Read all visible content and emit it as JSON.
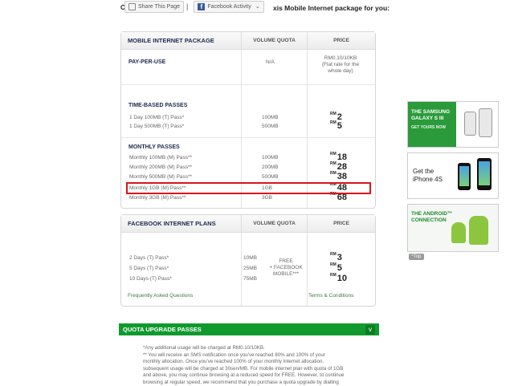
{
  "topbar": {
    "share_label": "Share This Page",
    "fb_label": "Facebook Activity",
    "intro_prefix": "C",
    "intro_text": "xis Mobile Internet package for you:"
  },
  "main_table": {
    "headers": {
      "package": "MOBILE INTERNET PACKAGE",
      "quota": "VOLUME QUOTA",
      "price": "PRICE"
    },
    "pay_per_use": {
      "title": "PAY-PER-USE",
      "quota": "N/A",
      "price_lines": [
        "RM0.10/10KB",
        "(Flat rate for the",
        "whole day)"
      ]
    },
    "time_based": {
      "title": "TIME-BASED PASSES",
      "rows": [
        {
          "name": "1 Day 100MB (T) Pass*",
          "quota": "100MB",
          "currency": "RM",
          "price": "2"
        },
        {
          "name": "1 Day 500MB (T) Pass*",
          "quota": "500MB",
          "currency": "RM",
          "price": "5"
        }
      ]
    },
    "monthly": {
      "title": "MONTHLY PASSES",
      "rows": [
        {
          "name": "Monthly 100MB (M) Pass**",
          "quota": "100MB",
          "currency": "RM",
          "price": "18"
        },
        {
          "name": "Monthly 200MB (M) Pass**",
          "quota": "200MB",
          "currency": "RM",
          "price": "28"
        },
        {
          "name": "Monthly 500MB (M) Pass**",
          "quota": "500MB",
          "currency": "RM",
          "price": "38"
        },
        {
          "name": "Monthly 1GB (M) Pass**",
          "quota": "1GB",
          "currency": "RM",
          "price": "48"
        },
        {
          "name": "Monthly 3GB (M) Pass**",
          "quota": "3GB",
          "currency": "RM",
          "price": "68"
        }
      ]
    }
  },
  "fb_table": {
    "headers": {
      "package": "FACEBOOK INTERNET PLANS",
      "quota": "VOLUME QUOTA",
      "price": "PRICE"
    },
    "rows": [
      {
        "name": "2 Days (T) Pass*",
        "quota": "10MB",
        "currency": "RM",
        "price": "3"
      },
      {
        "name": "5 Days (T) Pass*",
        "quota": "25MB",
        "currency": "RM",
        "price": "5"
      },
      {
        "name": "10 Days (T) Pass*",
        "quota": "75MB",
        "currency": "RM",
        "price": "10"
      }
    ],
    "free_note": "+ FREE FACEBOOK MOBILE***",
    "free_lines": [
      "FREE",
      "FACEBOOK",
      "MOBILE***"
    ],
    "plus": "+",
    "faq_link": "Frequently Asked Questions",
    "terms_link": "Terms & Conditions"
  },
  "quota_bar": {
    "label": "QUOTA UPGRADE PASSES",
    "chevron": "v"
  },
  "notes": [
    "*Any additional usage will be charged at RM0.10/10KB.",
    "** You will receive an SMS notification once you've reached 80% and 100% of your",
    "monthly allocation. Once you've reached 100% of your monthly Internet allocation,",
    "subsequent usage will be charged at 30sen/MB. For mobile internet plan with quota of 1GB",
    "and above, you may continue browsing at a reduced speed for FREE. However, to continue",
    "browsing at regular speed, we recommend that you purchase a quota upgrade by dialling"
  ],
  "ads": {
    "samsung": {
      "line1": "THE SAMSUNG",
      "line2": "GALAXY S III",
      "line3": "GET YOURS NOW"
    },
    "iphone": {
      "line1": "Get the",
      "line2": "iPhone 4S"
    },
    "android": {
      "line1": "THE ANDROID™",
      "line2": "CONNECTION"
    }
  },
  "to_top": "^Top",
  "colors": {
    "accent_green": "#109a2d",
    "highlight_red": "#d8161b",
    "header_navy": "#1c2a52"
  }
}
